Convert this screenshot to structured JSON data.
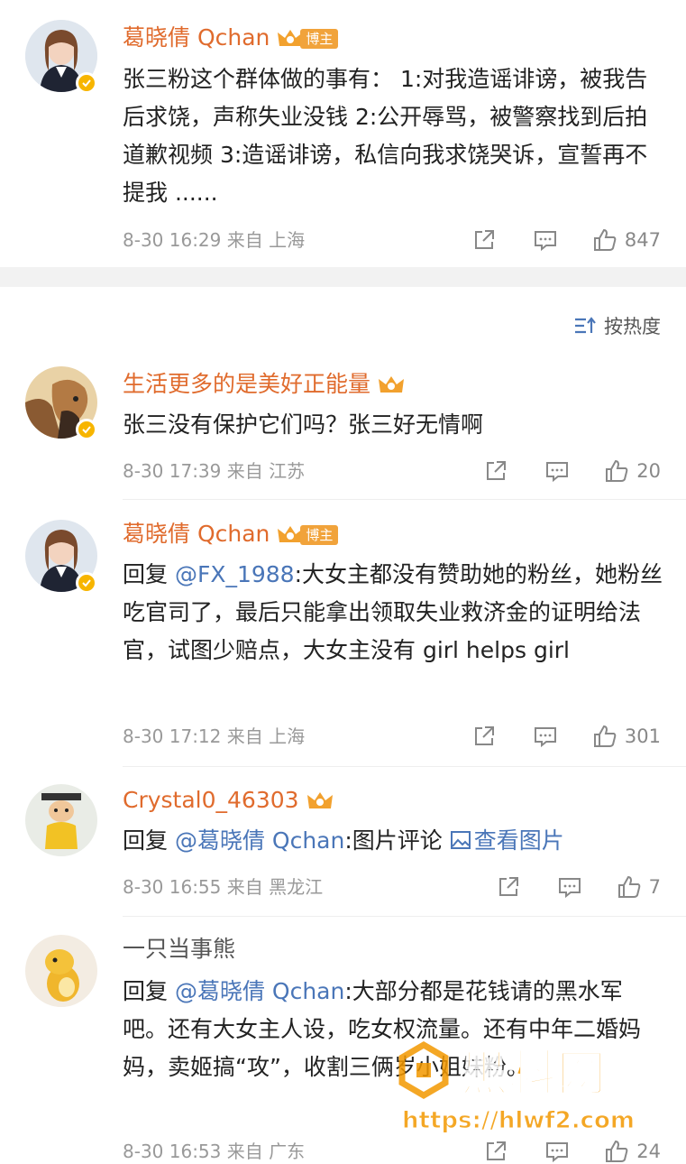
{
  "post": {
    "author": "葛晓倩 Qchan",
    "badge": "博主",
    "text": "张三粉这个群体做的事有： 1:对我造谣诽谤，被我告后求饶，声称失业没钱 2:公开辱骂，被警察找到后拍道歉视频 3:造谣诽谤，私信向我求饶哭诉，宣誓再不提我 ......",
    "time": "8-30 16:29 来自 上海",
    "likes": "847"
  },
  "sort_label": "按热度",
  "comments": [
    {
      "author": "生活更多的是美好正能量",
      "text": "张三没有保护它们吗？张三好无情啊",
      "time": "8-30 17:39 来自 江苏",
      "likes": "20"
    },
    {
      "author": "葛晓倩 Qchan",
      "badge": "博主",
      "reply_prefix": "回复 ",
      "mention": "@FX_1988",
      "text": ":大女主都没有赞助她的粉丝，她粉丝吃官司了，最后只能拿出领取失业救济金的证明给法官，试图少赔点，大女主没有 girl helps girl",
      "time": "8-30 17:12 来自 上海",
      "likes": "301"
    },
    {
      "author": "Crystal0_46303",
      "reply_prefix": "回复 ",
      "mention": "@葛晓倩 Qchan",
      "text": ":图片评论 ",
      "view_image": "查看图片",
      "time": "8-30 16:55 来自 黑龙江",
      "likes": "7"
    },
    {
      "author": "一只当事熊",
      "reply_prefix": "回复 ",
      "mention": "@葛晓倩 Qchan",
      "text": ":大部分都是花钱请的黑水军吧。还有大女主人设，吃女权流量。还有中年二婚妈妈，卖姬搞“攻”，收割三俩岁小姐妹粉。",
      "time": "8-30 16:53 来自 广东",
      "likes": "24"
    }
  ],
  "watermark": {
    "title": "黑料网",
    "url": "https://hlwf2.com"
  },
  "colors": {
    "name_orange": "#e06b2d",
    "link_blue": "#4a76b8",
    "badge_gold": "#f7b500",
    "meta_gray": "#999999"
  }
}
